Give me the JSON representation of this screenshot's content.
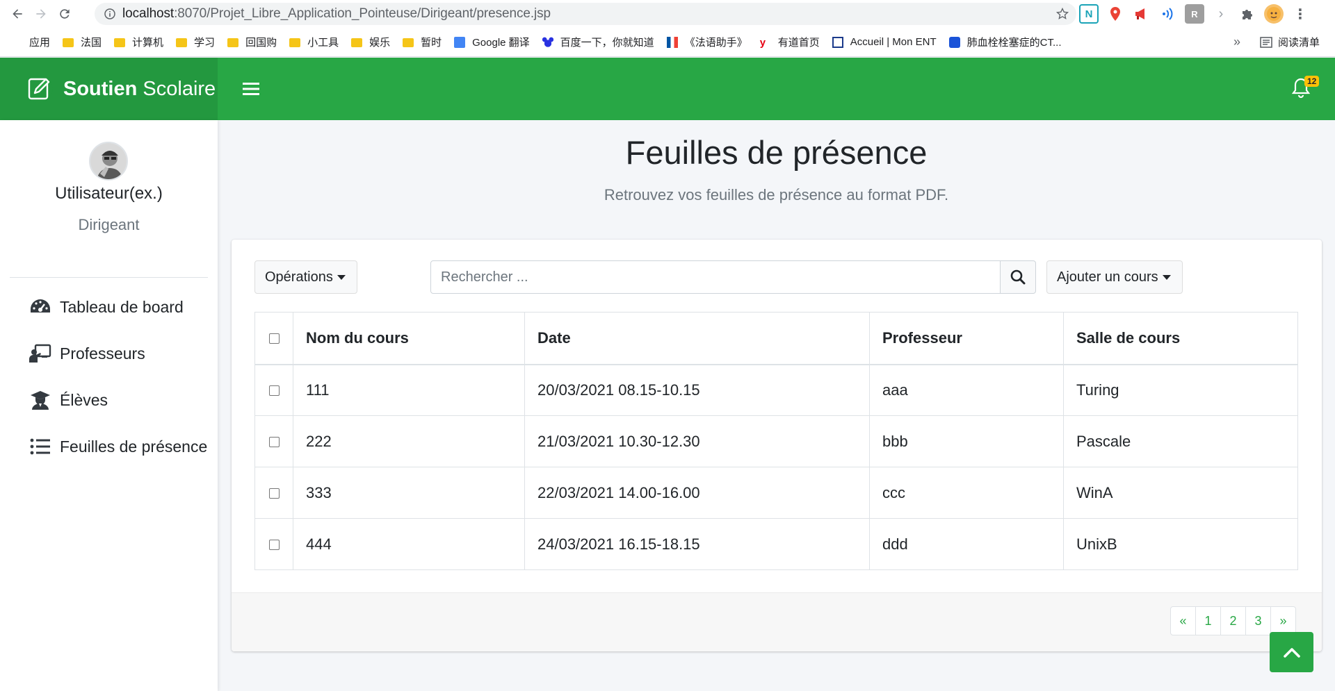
{
  "browser": {
    "url_host": "localhost",
    "url_path": ":8070/Projet_Libre_Application_Pointeuse/Dirigeant/presence.jsp",
    "bookmarks": [
      {
        "label": "应用",
        "icon": "apps-icon"
      },
      {
        "label": "法国",
        "icon": "folder-icon"
      },
      {
        "label": "计算机",
        "icon": "folder-icon"
      },
      {
        "label": "学习",
        "icon": "folder-icon"
      },
      {
        "label": "回国购",
        "icon": "folder-icon"
      },
      {
        "label": "小工具",
        "icon": "folder-icon"
      },
      {
        "label": "娱乐",
        "icon": "folder-icon"
      },
      {
        "label": "暂时",
        "icon": "folder-icon"
      },
      {
        "label": "Google 翻译",
        "icon": "google-translate-icon"
      },
      {
        "label": "百度一下，你就知道",
        "icon": "baidu-icon"
      },
      {
        "label": "《法语助手》",
        "icon": "france-flag-icon"
      },
      {
        "label": "有道首页",
        "icon": "youdao-icon"
      },
      {
        "label": "Accueil | Mon ENT",
        "icon": "ent-icon"
      },
      {
        "label": "肺血栓栓塞症的CT...",
        "icon": "doc-icon"
      }
    ],
    "bookmarks_more": "»",
    "reading_list": "阅读清单"
  },
  "header": {
    "brand_bold": "Soutien",
    "brand_rest": " Scolaire",
    "notification_count": "12",
    "accent_color": "#28a745"
  },
  "sidebar": {
    "user_name": "Utilisateur(ex.)",
    "user_role": "Dirigeant",
    "items": [
      {
        "label": "Tableau de board",
        "icon": "dashboard-gauge-icon"
      },
      {
        "label": "Professeurs",
        "icon": "teacher-board-icon"
      },
      {
        "label": "Élèves",
        "icon": "graduate-student-icon"
      },
      {
        "label": "Feuilles de présence",
        "icon": "list-icon"
      }
    ]
  },
  "main": {
    "title": "Feuilles de présence",
    "subtitle": "Retrouvez vos feuilles de présence au format PDF.",
    "operations_label": "Opérations",
    "search_placeholder": "Rechercher ...",
    "add_course_label": "Ajouter un cours",
    "table": {
      "headers": [
        "Nom du cours",
        "Date",
        "Professeur",
        "Salle de cours"
      ],
      "rows": [
        [
          "111",
          "20/03/2021 08.15-10.15",
          "aaa",
          "Turing"
        ],
        [
          "222",
          "21/03/2021 10.30-12.30",
          "bbb",
          "Pascale"
        ],
        [
          "333",
          "22/03/2021 14.00-16.00",
          "ccc",
          "WinA"
        ],
        [
          "444",
          "24/03/2021 16.15-18.15",
          "ddd",
          "UnixB"
        ]
      ]
    },
    "pagination": [
      "«",
      "1",
      "2",
      "3",
      "»"
    ]
  }
}
